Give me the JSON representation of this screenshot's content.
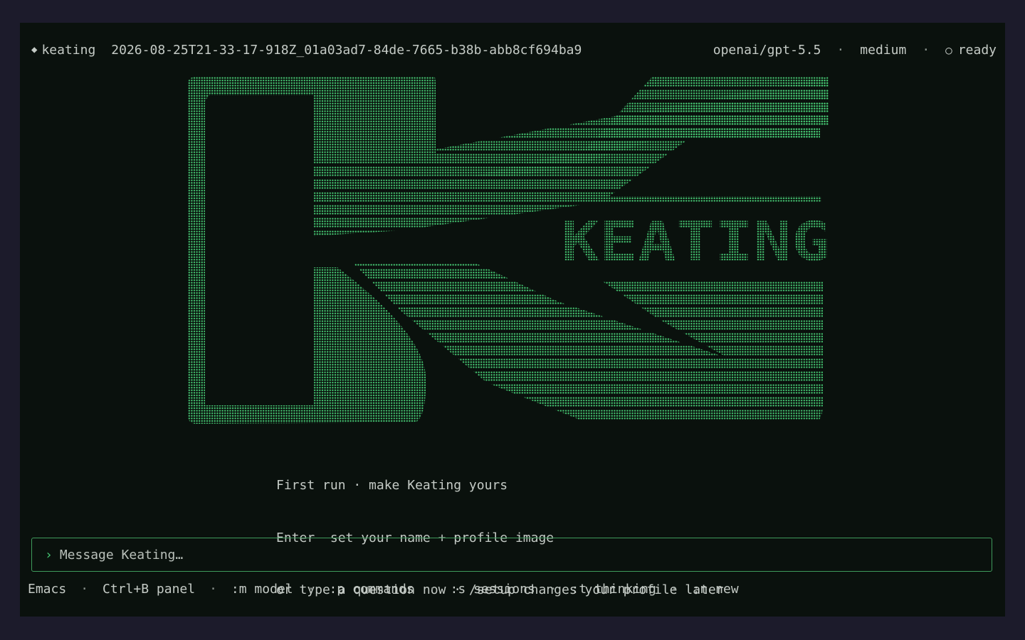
{
  "header": {
    "app_name": "keating",
    "session_id": "2026-08-25T21-33-17-918Z_01a03ad7-84de-7665-b38b-abb8cf694ba9",
    "model": "openai/gpt-5.5",
    "separator": "·",
    "effort": "medium",
    "status": "ready"
  },
  "logo": {
    "wordmark": "KEATING",
    "color": "#46c873"
  },
  "intro": {
    "line1": "First run · make Keating yours",
    "line2": "Enter  set your name + profile image",
    "line3": "or type a question now · /setup changes your profile later"
  },
  "composer": {
    "prompt_glyph": "›",
    "placeholder": "Message Keating…"
  },
  "footer": {
    "separator": "·",
    "items": [
      "Emacs",
      "Ctrl+B panel",
      ":m model",
      ":p commands",
      ":s sessions",
      ":t thinking",
      ":n new"
    ]
  },
  "colors": {
    "background": "#0a110d",
    "frame": "#1c1b2b",
    "accent": "#46c873",
    "text": "#c5cbc6",
    "border": "#3f9a5c"
  }
}
